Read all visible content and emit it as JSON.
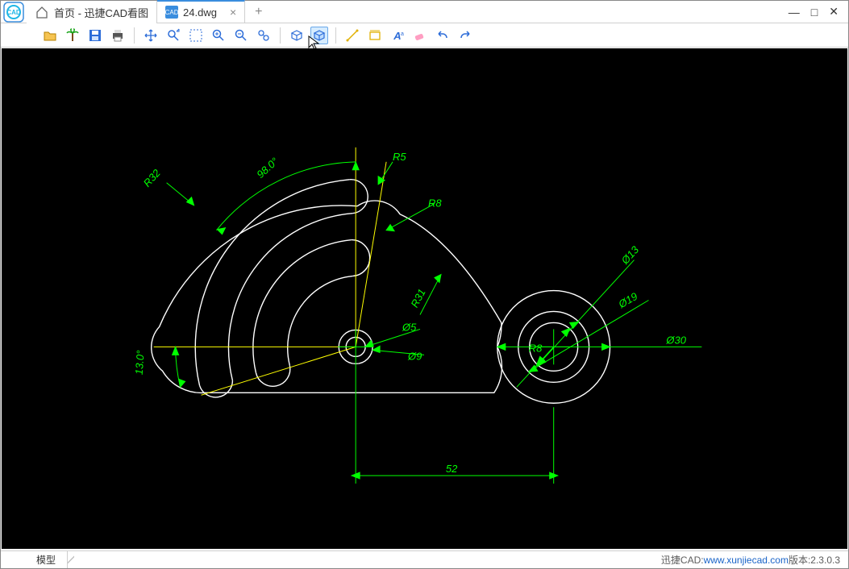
{
  "app": {
    "title": "迅捷CAD看图"
  },
  "tabs": {
    "home_label": "首页 - 迅捷CAD看图",
    "file_label": "24.dwg",
    "file_icon_text": "CAD"
  },
  "window_controls": {
    "minimize": "—",
    "maximize": "□",
    "close": "✕"
  },
  "toolbar": {
    "items": [
      {
        "name": "open-folder",
        "color": "#f0a400"
      },
      {
        "name": "palm",
        "color": "#1aa51a"
      },
      {
        "name": "save",
        "color": "#2c6cd8"
      },
      {
        "name": "print",
        "color": "#444"
      },
      {
        "name": "sep"
      },
      {
        "name": "move",
        "color": "#2c6cd8"
      },
      {
        "name": "zoom-window",
        "color": "#2c6cd8"
      },
      {
        "name": "zoom-region",
        "color": "#2c6cd8"
      },
      {
        "name": "zoom-in",
        "color": "#2c6cd8"
      },
      {
        "name": "zoom-out",
        "color": "#2c6cd8"
      },
      {
        "name": "zoom-extents",
        "color": "#2c6cd8"
      },
      {
        "name": "sep"
      },
      {
        "name": "3d-view",
        "color": "#2c6cd8"
      },
      {
        "name": "3d-orbit",
        "color": "#2c6cd8",
        "selected": true
      },
      {
        "name": "sep"
      },
      {
        "name": "measure-dist",
        "color": "#e0b000"
      },
      {
        "name": "measure-area",
        "color": "#e0b000"
      },
      {
        "name": "text-annot",
        "color": "#2c6cd8"
      },
      {
        "name": "eraser",
        "color": "#ff6aa0"
      },
      {
        "name": "undo",
        "color": "#2c6cd8"
      },
      {
        "name": "redo",
        "color": "#2c6cd8"
      }
    ]
  },
  "bottom": {
    "model_tab": "模型",
    "brand": "迅捷CAD: ",
    "link": "www.xunjiecad.com",
    "version_label": " 版本: ",
    "version": "2.3.0.3"
  },
  "drawing": {
    "colors": {
      "outline": "#ffffff",
      "dim": "#00ff00",
      "aux": "#ffff00"
    },
    "dims": {
      "angle_large": "98.0°",
      "angle_small": "13.0°",
      "r32": "R32",
      "r5": "R5",
      "r8_top": "R8",
      "r31": "R31",
      "r8_right": "R8",
      "d5": "Ø5",
      "d9": "Ø9",
      "d13": "Ø13",
      "d19": "Ø19",
      "d30": "Ø30",
      "len52": "52"
    }
  }
}
